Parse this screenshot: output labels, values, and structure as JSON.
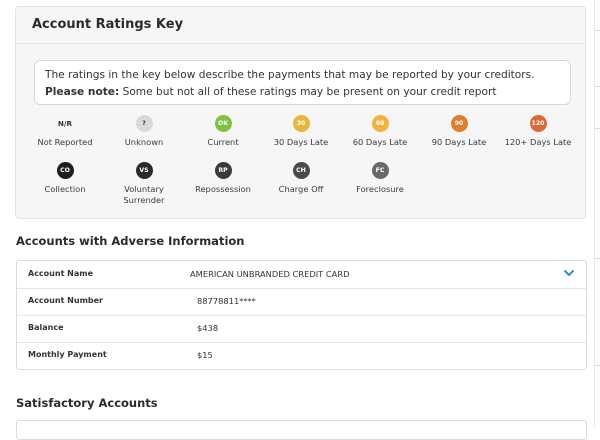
{
  "ratings_key": {
    "title": "Account Ratings Key",
    "notice_text": "The ratings in the key below describe the payments that may be reported by your creditors.",
    "notice_bold": "Please note:",
    "notice_text_2": "Some but not all of these ratings may be present on your credit report",
    "items": [
      {
        "code": "N/R",
        "label": "Not Reported",
        "color": "transparent",
        "text_color": "#333333"
      },
      {
        "code": "?",
        "label": "Unknown",
        "color": "#d9d9d9",
        "text_color": "#333333"
      },
      {
        "code": "OK",
        "label": "Current",
        "color": "#7fc242",
        "text_color": "#ffffff"
      },
      {
        "code": "30",
        "label": "30 Days Late",
        "color": "#e5b93a",
        "text_color": "#ffffff"
      },
      {
        "code": "60",
        "label": "60 Days Late",
        "color": "#f2b23e",
        "text_color": "#ffffff"
      },
      {
        "code": "90",
        "label": "90 Days Late",
        "color": "#e27d2f",
        "text_color": "#ffffff"
      },
      {
        "code": "120",
        "label": "120+ Days Late",
        "color": "#dd6a34",
        "text_color": "#ffffff"
      },
      {
        "code": "CO",
        "label": "Collection",
        "color": "#1f1f1f",
        "text_color": "#ffffff"
      },
      {
        "code": "VS",
        "label": "Voluntary Surrender",
        "color": "#2a2a2a",
        "text_color": "#ffffff"
      },
      {
        "code": "RP",
        "label": "Repossession",
        "color": "#3a3a3a",
        "text_color": "#ffffff"
      },
      {
        "code": "CH",
        "label": "Charge Off",
        "color": "#4a4a4a",
        "text_color": "#ffffff"
      },
      {
        "code": "FC",
        "label": "Foreclosure",
        "color": "#6a6a6a",
        "text_color": "#ffffff"
      }
    ]
  },
  "adverse": {
    "heading": "Accounts with Adverse Information",
    "rows": [
      {
        "label": "Account Name",
        "value": "AMERICAN UNBRANDED CREDIT CARD"
      },
      {
        "label": "Account Number",
        "value": "88778811****"
      },
      {
        "label": "Balance",
        "value": "$438"
      },
      {
        "label": "Monthly Payment",
        "value": "$15"
      }
    ],
    "expand_icon": "chevron-down-icon",
    "accent_color": "#2a8fd4"
  },
  "satisfactory": {
    "heading": "Satisfactory Accounts"
  }
}
